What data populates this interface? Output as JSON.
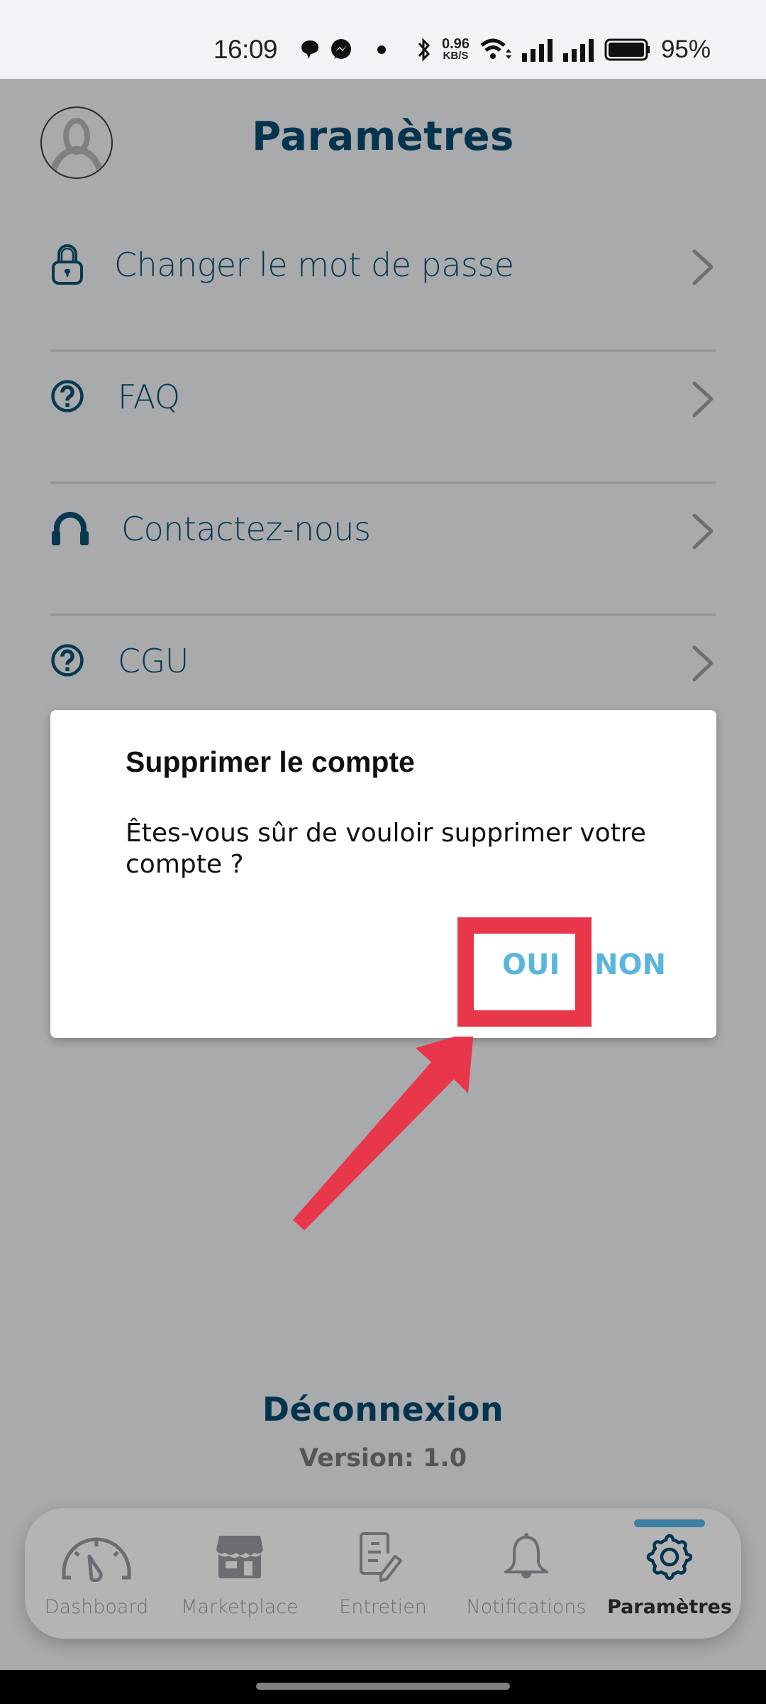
{
  "status_bar": {
    "time": "16:09",
    "notification_icons": [
      "chat-bubble-icon",
      "messenger-icon",
      "dot-icon"
    ],
    "network_speed_value": "0.96",
    "network_speed_unit": "KB/S",
    "battery_percent": "95%"
  },
  "header": {
    "title": "Paramètres",
    "avatar_icon": "user-avatar-icon"
  },
  "menu": {
    "items": [
      {
        "label": "Changer le mot de passe",
        "icon": "lock-icon"
      },
      {
        "label": "FAQ",
        "icon": "question-circle-icon"
      },
      {
        "label": "Contactez-nous",
        "icon": "headphones-icon"
      },
      {
        "label": "CGU",
        "icon": "question-circle-icon"
      }
    ]
  },
  "dialog": {
    "title": "Supprimer le compte",
    "message": "Êtes-vous sûr de vouloir supprimer votre compte ?",
    "confirm_label": "OUI",
    "cancel_label": "NON"
  },
  "annotation": {
    "color": "#e8364a",
    "target": "OUI"
  },
  "footer": {
    "logout_label": "Déconnexion",
    "version_text": "Version:  1.0"
  },
  "bottom_nav": {
    "active_index": 4,
    "items": [
      {
        "label": "Dashboard",
        "icon": "speedometer-icon"
      },
      {
        "label": "Marketplace",
        "icon": "store-icon"
      },
      {
        "label": "Entretien",
        "icon": "document-edit-icon"
      },
      {
        "label": "Notifications",
        "icon": "bell-icon"
      },
      {
        "label": "Paramètres",
        "icon": "gear-icon"
      }
    ]
  },
  "colors": {
    "primary": "#04344d",
    "dialog_button": "#5ab5de",
    "nav_indicator": "#3d7fa1",
    "annotation": "#e8364a"
  }
}
